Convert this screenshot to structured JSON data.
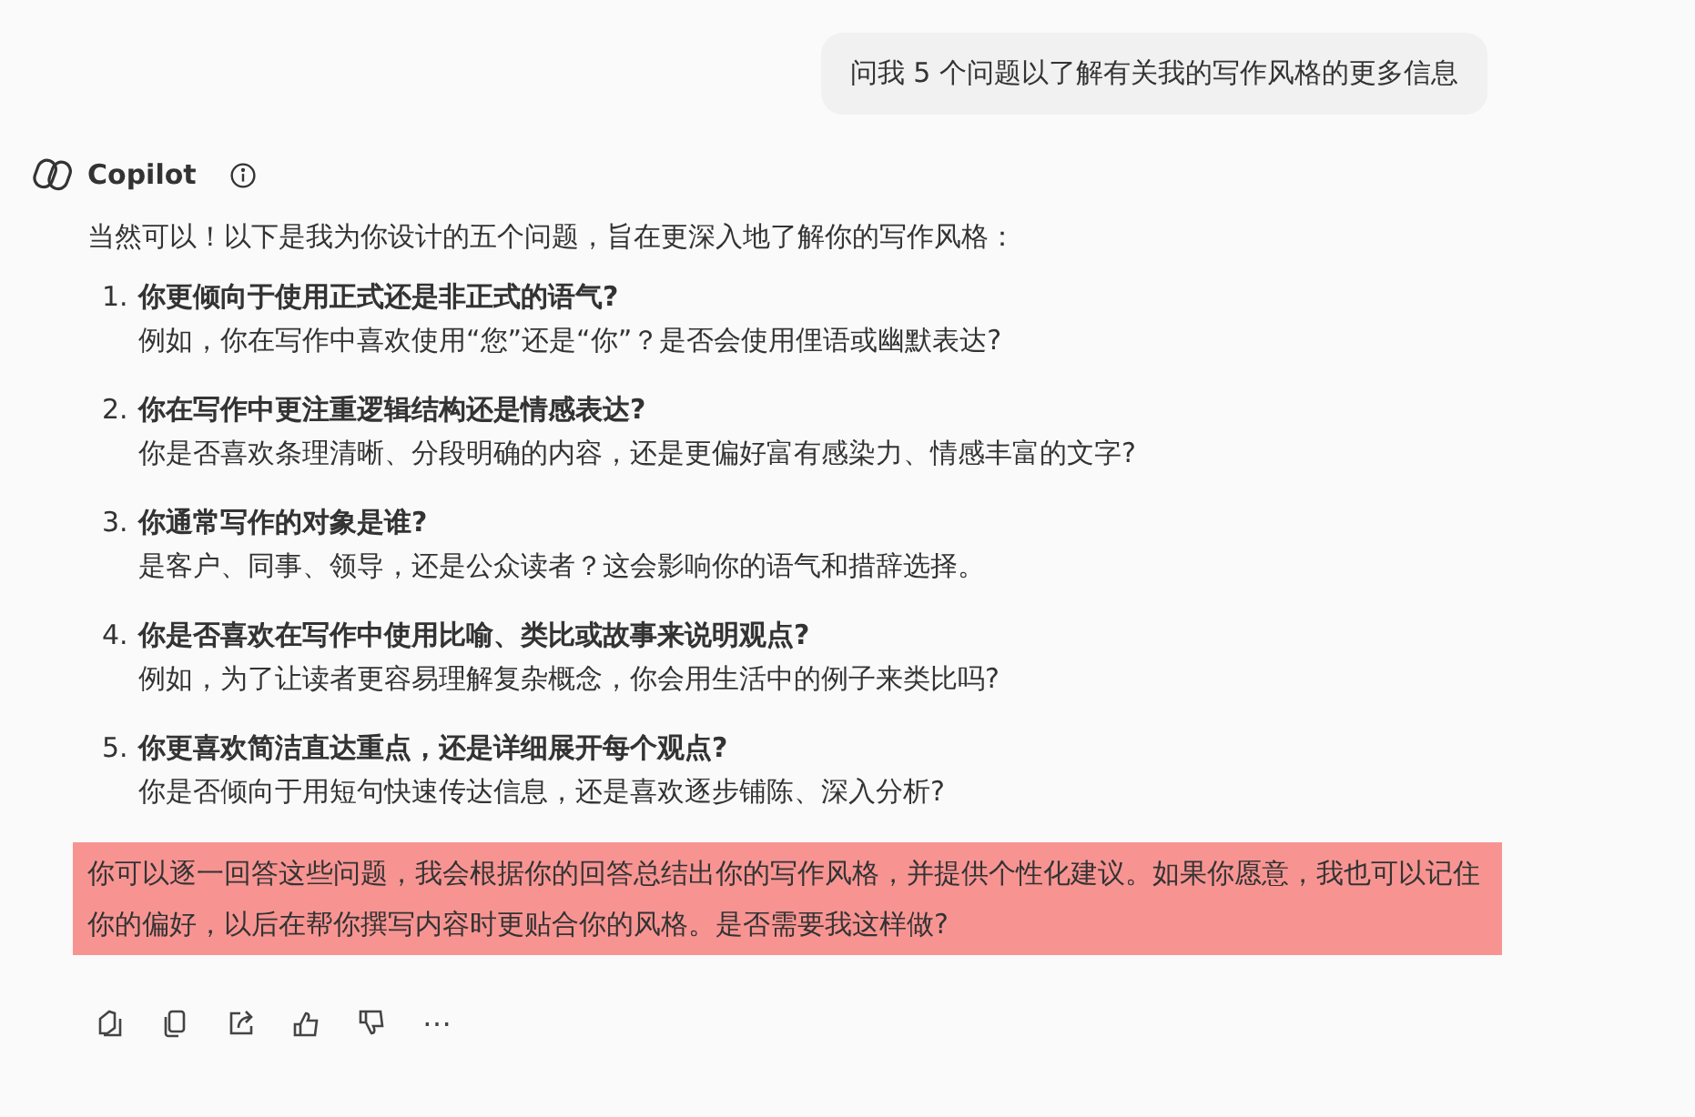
{
  "user_message": "问我 5 个问题以了解有关我的写作风格的更多信息",
  "assistant": {
    "name": "Copilot",
    "intro": "当然可以！以下是我为你设计的五个问题，旨在更深入地了解你的写作风格：",
    "questions": [
      {
        "number": "1.",
        "title": "你更倾向于使用正式还是非正式的语气?",
        "detail": "例如，你在写作中喜欢使用“您”还是“你”？是否会使用俚语或幽默表达?"
      },
      {
        "number": "2.",
        "title": "你在写作中更注重逻辑结构还是情感表达?",
        "detail": "你是否喜欢条理清晰、分段明确的内容，还是更偏好富有感染力、情感丰富的文字?"
      },
      {
        "number": "3.",
        "title": "你通常写作的对象是谁?",
        "detail": "是客户、同事、领导，还是公众读者？这会影响你的语气和措辞选择。"
      },
      {
        "number": "4.",
        "title": "你是否喜欢在写作中使用比喻、类比或故事来说明观点?",
        "detail": "例如，为了让读者更容易理解复杂概念，你会用生活中的例子来类比吗?"
      },
      {
        "number": "5.",
        "title": "你更喜欢简洁直达重点，还是详细展开每个观点?",
        "detail": "你是否倾向于用短句快速传达信息，还是喜欢逐步铺陈、深入分析?"
      }
    ],
    "closing": {
      "text": "你可以逐一回答这些问题，我会根据你的回答总结出你的写作风格，并提供个性化建议。如果你愿意，我也可以记住你的偏好，以后在帮你撰写内容时更贴合你的风格。是否需要我这样做?",
      "highlighted": true
    },
    "more_label": "⋯"
  }
}
